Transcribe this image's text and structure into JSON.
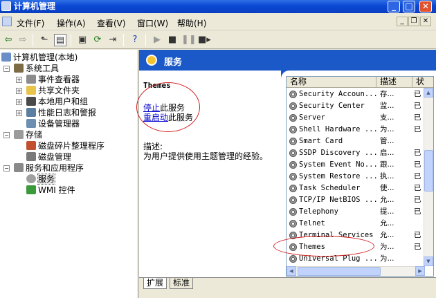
{
  "window": {
    "title": "计算机管理"
  },
  "menu": [
    "文件(F)",
    "操作(A)",
    "查看(V)",
    "窗口(W)",
    "帮助(H)"
  ],
  "tree": {
    "root": "计算机管理(本地)",
    "items": [
      {
        "label": "系统工具"
      },
      {
        "label": "事件查看器"
      },
      {
        "label": "共享文件夹"
      },
      {
        "label": "本地用户和组"
      },
      {
        "label": "性能日志和警报"
      },
      {
        "label": "设备管理器"
      },
      {
        "label": "存储"
      },
      {
        "label": "磁盘碎片整理程序"
      },
      {
        "label": "磁盘管理"
      },
      {
        "label": "服务和应用程序"
      },
      {
        "label": "服务"
      },
      {
        "label": "WMI 控件"
      }
    ]
  },
  "panel": {
    "header": "服务",
    "selected_name": "Themes",
    "stop_link": "停止",
    "stop_rest": "此服务",
    "restart_link": "重启动",
    "restart_rest": "此服务",
    "desc_label": "描述:",
    "desc_text": "为用户提供使用主题管理的经验。"
  },
  "list": {
    "columns": [
      "名称",
      "描述",
      "状"
    ],
    "rows": [
      {
        "name": "Security Accoun...",
        "desc": "存...",
        "status": "已"
      },
      {
        "name": "Security Center",
        "desc": "监...",
        "status": "已"
      },
      {
        "name": "Server",
        "desc": "支...",
        "status": "已"
      },
      {
        "name": "Shell Hardware ...",
        "desc": "为...",
        "status": "已"
      },
      {
        "name": "Smart Card",
        "desc": "管...",
        "status": ""
      },
      {
        "name": "SSDP Discovery ...",
        "desc": "启...",
        "status": "已"
      },
      {
        "name": "System Event No...",
        "desc": "跟...",
        "status": "已"
      },
      {
        "name": "System Restore ...",
        "desc": "执...",
        "status": "已"
      },
      {
        "name": "Task Scheduler",
        "desc": "使...",
        "status": "已"
      },
      {
        "name": "TCP/IP NetBIOS ...",
        "desc": "允...",
        "status": "已"
      },
      {
        "name": "Telephony",
        "desc": "提...",
        "status": "已"
      },
      {
        "name": "Telnet",
        "desc": "允...",
        "status": ""
      },
      {
        "name": "Terminal Services",
        "desc": "允...",
        "status": "已"
      },
      {
        "name": "Themes",
        "desc": "为...",
        "status": "已"
      },
      {
        "name": "Universal Plug ...",
        "desc": "为...",
        "status": ""
      }
    ]
  },
  "tabs": [
    "扩展",
    "标准"
  ],
  "colors": {
    "header_blue": "#1b59c8",
    "title_blue": "#0a48d4",
    "annotation_red": "#d02020"
  }
}
